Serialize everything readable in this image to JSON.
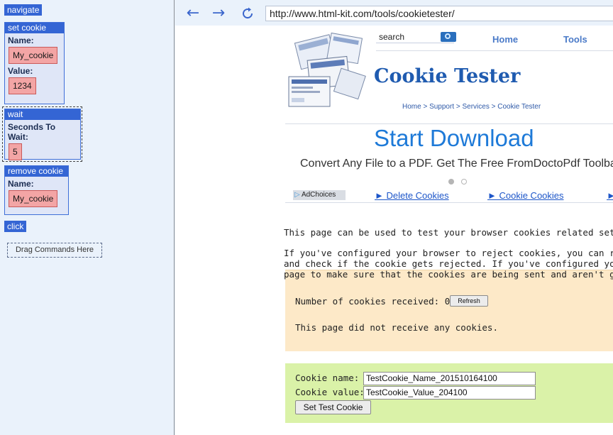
{
  "commands": {
    "navigate_label": "navigate",
    "set_cookie": {
      "header": "set cookie",
      "name_label": "Name:",
      "name_value": "My_cookie",
      "value_label": "Value:",
      "value_value": "1234"
    },
    "wait": {
      "header": "wait",
      "seconds_label": "Seconds To Wait:",
      "seconds_value": "5"
    },
    "remove_cookie": {
      "header": "remove cookie",
      "name_label": "Name:",
      "name_value": "My_cookie"
    },
    "click_label": "click",
    "drop_zone_label": "Drag Commands Here"
  },
  "browser": {
    "back_icon": "arrow-left-icon",
    "forward_icon": "arrow-right-icon",
    "reload_icon": "reload-icon",
    "url": "http://www.html-kit.com/tools/cookietester/"
  },
  "page": {
    "search_label": "search",
    "nav_home": "Home",
    "nav_tools": "Tools",
    "title": "Cookie Tester",
    "breadcrumb": "Home > Support > Services > Cookie Tester",
    "ad_headline": "Start Download",
    "ad_subline": "Convert Any File to a PDF. Get The Free FromDoctoPdf Toolbar",
    "adchoices_label": "AdChoices",
    "ad_links": [
      "► Delete Cookies",
      "► Cookie Cookies",
      "►"
    ],
    "intro": "This page can be used to test your browser cookies related settings.",
    "paragraph_lines": [
      "If you've configured your browser to reject cookies, you can request this page",
      "and check if the cookie gets rejected. If you've configured your browser to",
      "page to make sure that the cookies are being sent and aren't getting lost."
    ],
    "cookie_count_label": "Number of cookies received: 0",
    "refresh_label": "Refresh",
    "no_cookies_msg": "This page did not receive any cookies.",
    "cookie_name_label": "Cookie name:",
    "cookie_name_value": "TestCookie_Name_201510164100",
    "cookie_value_label": "Cookie value:",
    "cookie_value_value": "TestCookie_Value_204100",
    "set_button_label": "Set Test Cookie"
  },
  "colors": {
    "command_blue": "#3465d4",
    "value_pink": "#f3a5a5",
    "ad_blue": "#1e7ad8",
    "result_bg": "#fde9c8",
    "set_bg": "#daf2a8"
  }
}
